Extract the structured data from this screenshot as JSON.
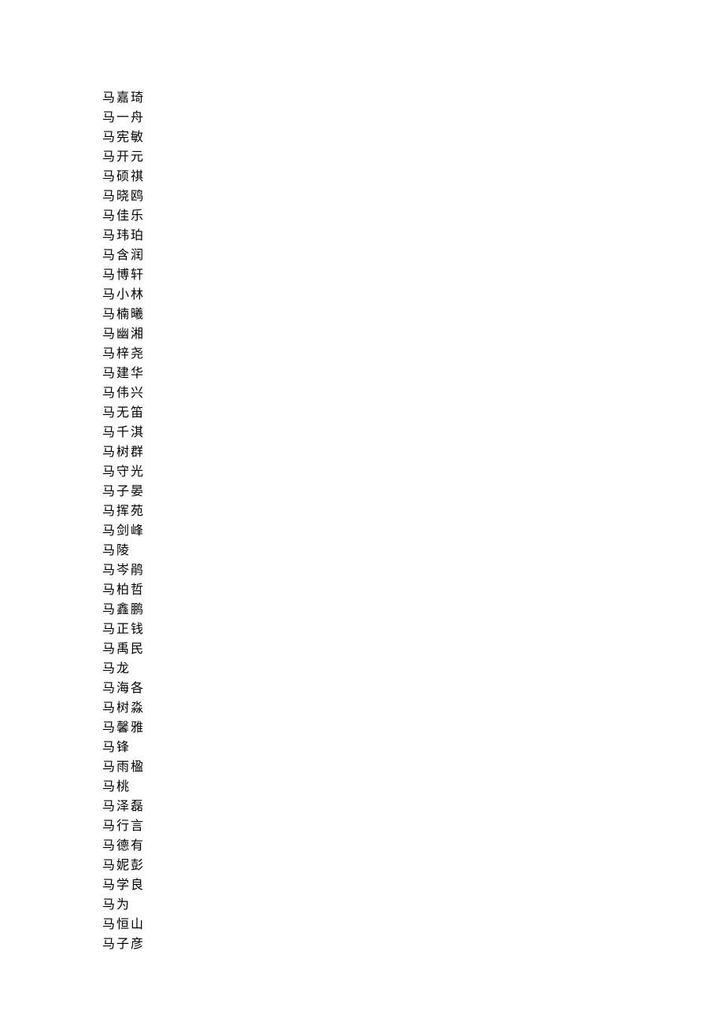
{
  "names": [
    "马嘉琦",
    "马一舟",
    "马宪敏",
    "马开元",
    "马硕祺",
    "马晓鸥",
    "马佳乐",
    "马玮珀",
    "马含润",
    "马博轩",
    "马小林",
    "马楠曦",
    "马幽湘",
    "马梓尧",
    "马建华",
    "马伟兴",
    "马无笛",
    "马千淇",
    "马树群",
    "马守光",
    "马子晏",
    "马挥苑",
    "马剑峰",
    "马陵",
    "马岑鹃",
    "马柏哲",
    "马鑫鹏",
    "马正钱",
    "马禹民",
    "马龙",
    "马海各",
    "马树淼",
    "马馨雅",
    "马锋",
    "马雨楹",
    "马桃",
    "马泽磊",
    "马行言",
    "马德有",
    "马妮彭",
    "马学良",
    "马为",
    "马恒山",
    "马子彦"
  ]
}
